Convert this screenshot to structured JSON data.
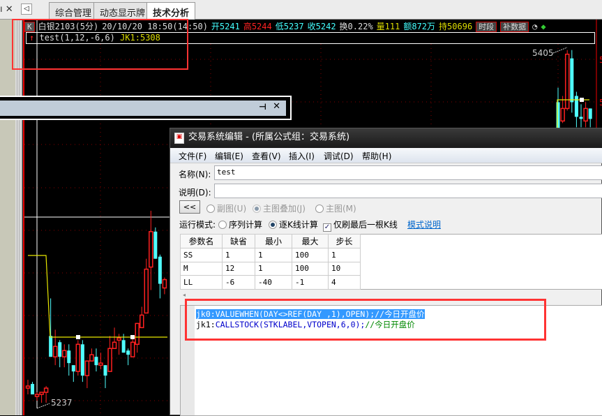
{
  "tabs": [
    {
      "label": "综合管理",
      "active": false
    },
    {
      "label": "动态显示牌",
      "active": false
    },
    {
      "label": "技术分析",
      "active": true
    }
  ],
  "info": {
    "k_label": "K",
    "symbol": "白银2103(5分)",
    "datetime": "20/10/20 18:50(14:50)",
    "open": "开5241",
    "high": "高5244",
    "low": "低5237",
    "close": "收5242",
    "turnover": "换0.22%",
    "volume": "量111",
    "amount": "额872万",
    "position": "持50696",
    "btn_period": "时段",
    "btn_fill": "补数据"
  },
  "indicator": {
    "name": "test(1,12,-6,6)",
    "value": "JK1:5308"
  },
  "price_labels": {
    "high": "5405",
    "low": "5237"
  },
  "candles_left": [
    [
      5244,
      5245,
      5248,
      5241
    ],
    [
      5246,
      5241,
      5247,
      5241
    ],
    [
      5240,
      5241,
      5242,
      5238
    ],
    [
      5241,
      5242,
      5242,
      5237
    ],
    [
      5242,
      5244,
      5245,
      5237
    ],
    [
      5269,
      5259,
      5287,
      5259
    ],
    [
      5259,
      5264,
      5272,
      5255
    ],
    [
      5266,
      5259,
      5267,
      5254
    ],
    [
      5259,
      5262,
      5265,
      5254
    ],
    [
      5262,
      5256,
      5265,
      5250
    ],
    [
      5255,
      5252,
      5255,
      5247
    ],
    [
      5252,
      5265,
      5267,
      5250
    ],
    [
      5265,
      5250,
      5267,
      5247
    ],
    [
      5250,
      5257,
      5257,
      5244
    ],
    [
      5257,
      5260,
      5263,
      5257
    ],
    [
      5259,
      5255,
      5263,
      5252
    ],
    [
      5255,
      5256,
      5261,
      5253
    ],
    [
      5255,
      5250,
      5255,
      5244
    ],
    [
      5252,
      5263,
      5269,
      5252
    ],
    [
      5263,
      5266,
      5273,
      5263
    ],
    [
      5267,
      5268,
      5270,
      5260
    ],
    [
      5267,
      5261,
      5270,
      5261
    ],
    [
      5262,
      5260,
      5263,
      5255
    ],
    [
      5259,
      5266,
      5268,
      5259
    ],
    [
      5265,
      5275,
      5275,
      5261
    ],
    [
      5273,
      5279,
      5283,
      5273
    ],
    [
      5280,
      5301,
      5306,
      5280
    ],
    [
      5302,
      5319,
      5329,
      5291
    ],
    [
      5319,
      5306,
      5321,
      5306
    ],
    [
      5307,
      5294,
      5308,
      5287
    ],
    [
      5292,
      5296,
      5297,
      5289
    ]
  ],
  "candles_right": [
    [
      5381,
      5368,
      5388,
      5366
    ],
    [
      5372,
      5378,
      5384,
      5371
    ],
    [
      5378,
      5404,
      5406,
      5377
    ],
    [
      5402,
      5381,
      5406,
      5376
    ],
    [
      5384,
      5374,
      5386,
      5369
    ],
    [
      5374,
      5373,
      5380,
      5369
    ],
    [
      5372,
      5378,
      5381,
      5369
    ],
    [
      5378,
      5373,
      5378,
      5369
    ]
  ],
  "dialog": {
    "title": "交易系统编辑 - (所属公式组：交易系统)",
    "menu": [
      "文件(F)",
      "编辑(E)",
      "查看(V)",
      "插入(I)",
      "调试(D)",
      "帮助(H)"
    ],
    "name_label": "名称(N):",
    "name_value": "test",
    "desc_label": "说明(D):",
    "desc_value": "",
    "collapse_btn": "<<",
    "radio_sub": "副图(U)",
    "radio_overlay": "主图叠加(J)",
    "radio_main": "主图(M)",
    "run_mode_label": "运行模式:",
    "mode_series": "序列计算",
    "mode_tick": "逐K线计算",
    "only_last": "仅刷最后一根K线",
    "mode_help": "模式说明",
    "table_headers": [
      "参数名",
      "缺省",
      "最小",
      "最大",
      "步长"
    ],
    "params": [
      [
        "SS",
        "1",
        "1",
        "100",
        "1"
      ],
      [
        "M",
        "12",
        "1",
        "100",
        "10"
      ],
      [
        "LL",
        "-6",
        "-40",
        "-1",
        "4"
      ]
    ],
    "code": [
      {
        "prefix": "jk0:",
        "body": "VALUEWHEN(DAY<>REF(DAY ,1),OPEN);",
        "comment": "//今日开盘价"
      },
      {
        "prefix": "jk1:",
        "body": "CALLSTOCK(STKLABEL,VTOPEN,6,0);",
        "comment": "//今日开盘价"
      }
    ]
  },
  "colors": {
    "up": "#ff2020",
    "down": "#50ffff",
    "ma": "#e8e800",
    "annotation": "#ff3333"
  }
}
